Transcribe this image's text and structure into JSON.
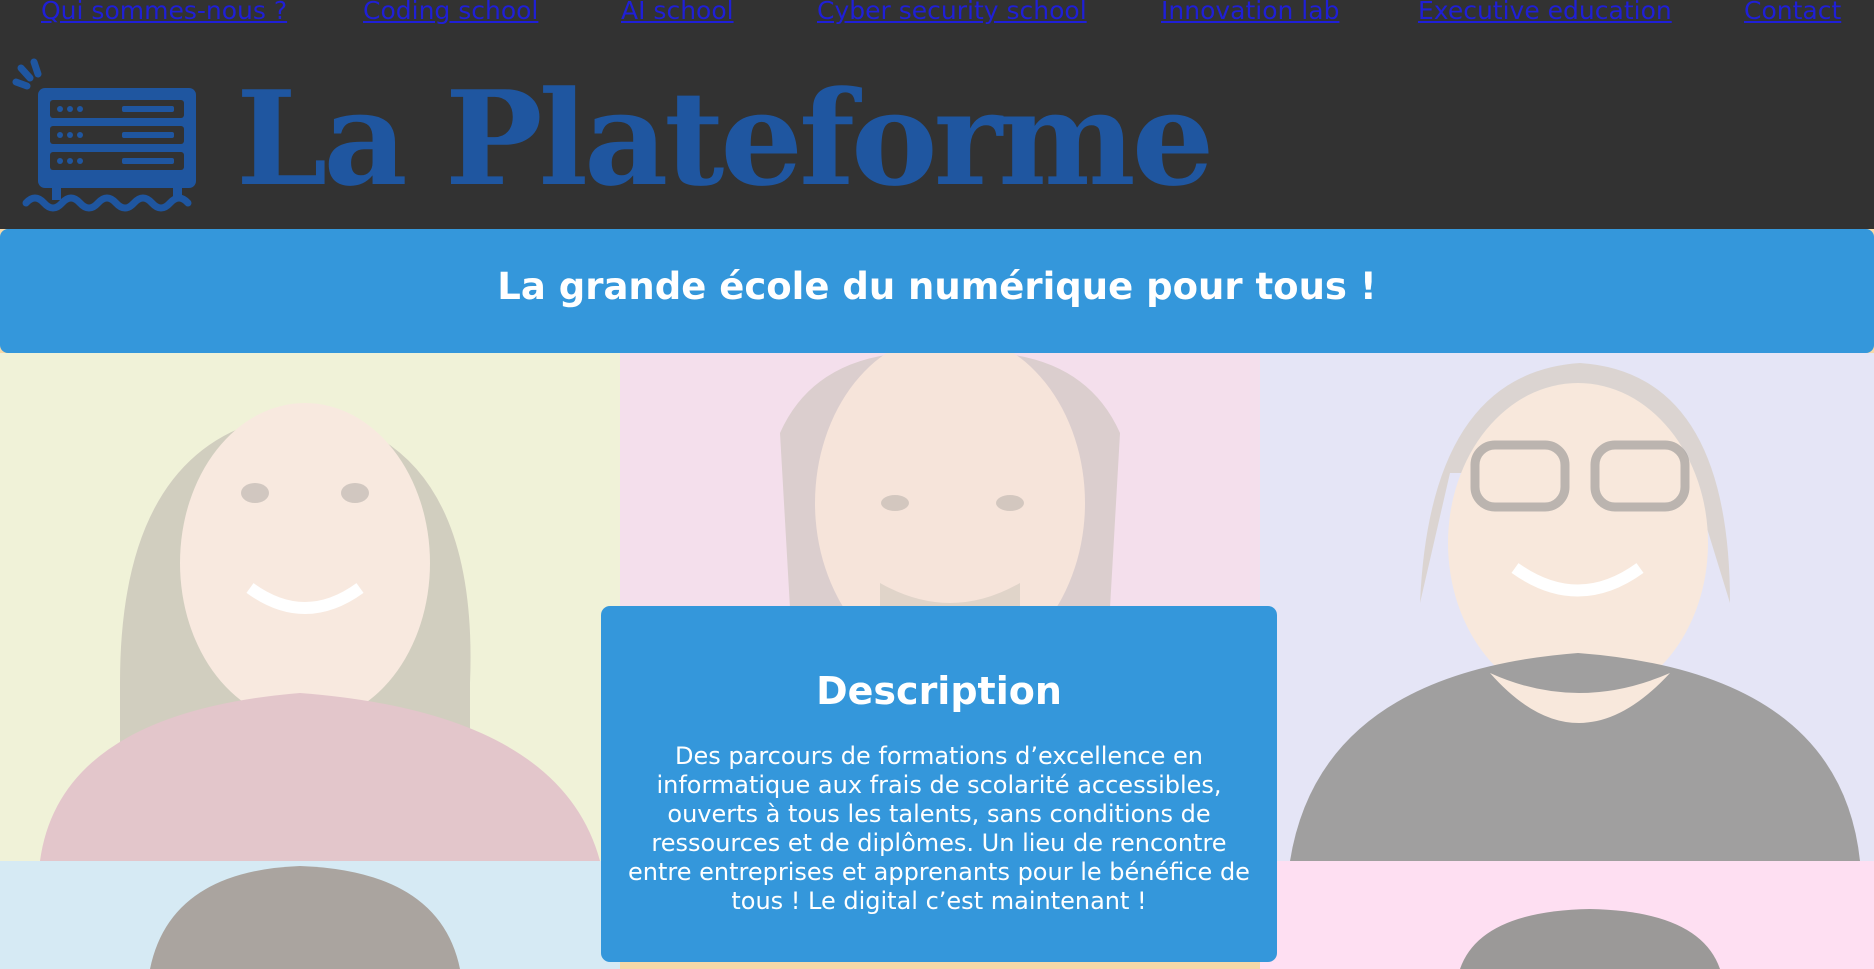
{
  "nav": {
    "items": [
      {
        "label": "Qui sommes-nous ?"
      },
      {
        "label": "Coding school"
      },
      {
        "label": "AI school"
      },
      {
        "label": "Cyber security school"
      },
      {
        "label": "Innovation lab"
      },
      {
        "label": "Executive education"
      },
      {
        "label": "Contact"
      }
    ]
  },
  "logo": {
    "text": "La Plateforme",
    "icon": "server-rack-icon",
    "color": "#1f56a0"
  },
  "banner": {
    "title": "La grande école du numérique pour tous !",
    "color": "#3497db"
  },
  "description": {
    "title": "Description",
    "body": "Des parcours de formations d’excellence en informatique aux frais de scolarité accessibles, ouverts à tous les talents, sans conditions de ressources et de diplômes. Un lieu de rencontre entre entreprises et apprenants pour le bénéfice de tous ! Le digital c’est maintenant !"
  },
  "colors": {
    "header_bg": "#323232",
    "link": "#1f1fd6",
    "accent": "#3497db"
  }
}
